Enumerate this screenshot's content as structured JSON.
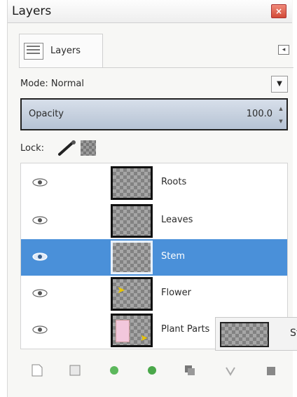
{
  "window": {
    "title": "Layers",
    "close_glyph": "×"
  },
  "tab": {
    "label": "Layers",
    "icon": "layers-icon",
    "menu_glyph": "◂"
  },
  "mode": {
    "label": "Mode: Normal",
    "dropdown_glyph": "▼"
  },
  "opacity": {
    "label": "Opacity",
    "value": "100.0"
  },
  "lock": {
    "label": "Lock:",
    "icons": [
      "paint-lock-icon",
      "alpha-lock-icon"
    ]
  },
  "layers": [
    {
      "name": "Roots",
      "visible": true,
      "selected": false
    },
    {
      "name": "Leaves",
      "visible": true,
      "selected": false
    },
    {
      "name": "Stem",
      "visible": true,
      "selected": true
    },
    {
      "name": "Flower",
      "visible": true,
      "selected": false
    },
    {
      "name": "Plant Parts",
      "visible": true,
      "selected": false
    }
  ],
  "tooltip": {
    "text": "St"
  },
  "toolbar_icons": [
    "new-layer-icon",
    "new-group-icon",
    "raise-layer-icon",
    "lower-layer-icon",
    "duplicate-layer-icon",
    "anchor-layer-icon",
    "delete-layer-icon"
  ],
  "colors": {
    "selection": "#4a90d9",
    "close_button": "#d24a37",
    "arrow": "#e8c400"
  }
}
